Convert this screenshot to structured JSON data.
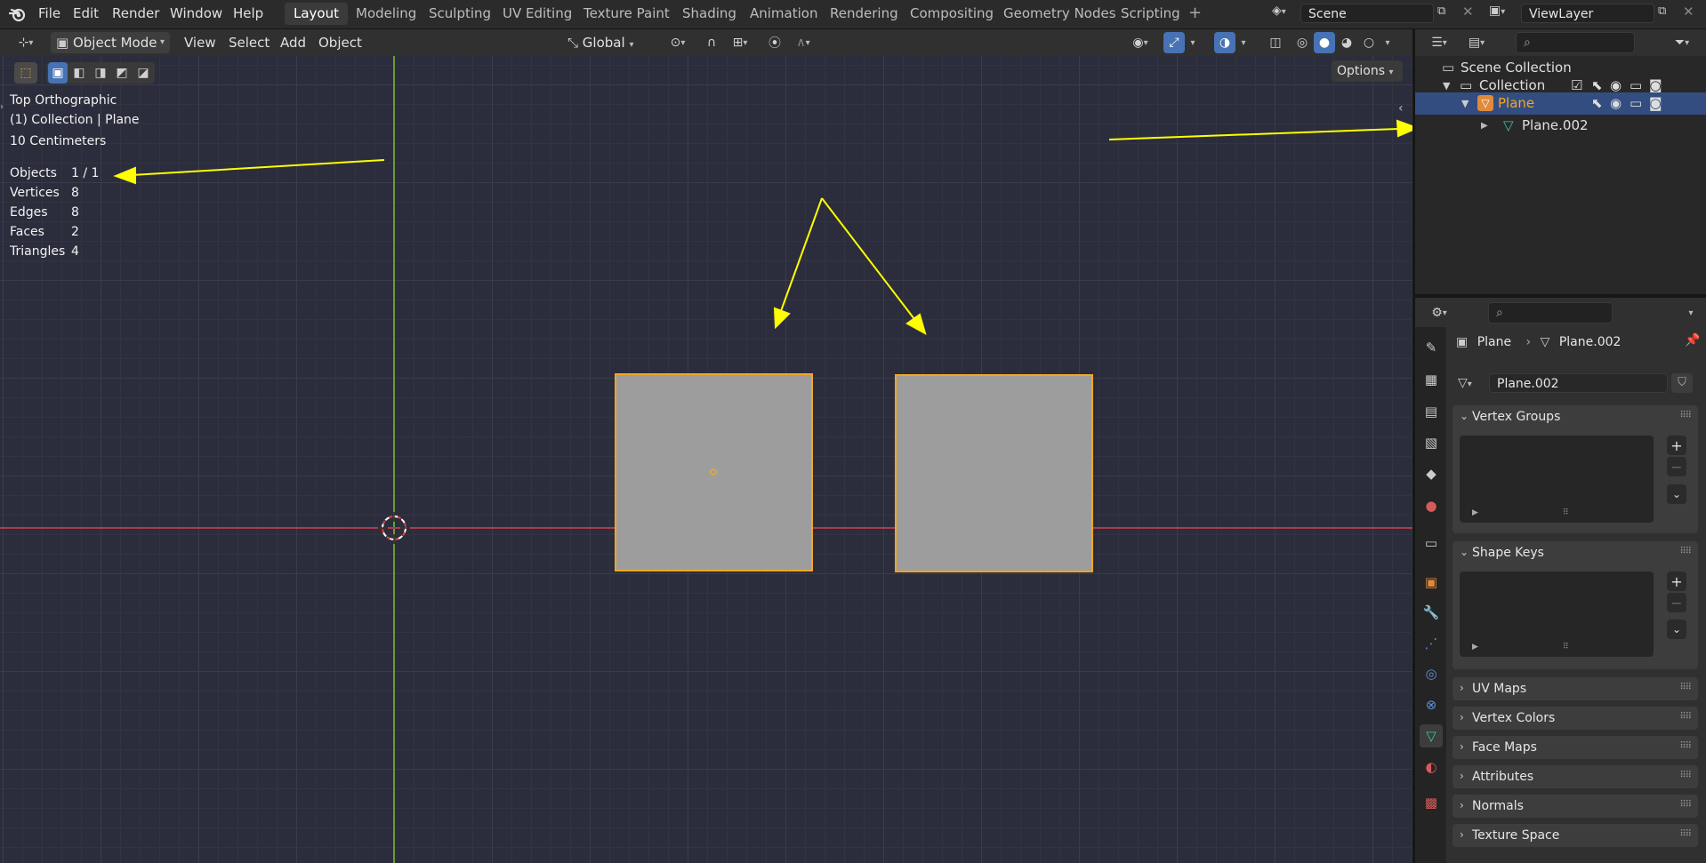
{
  "app": {
    "menus": [
      "File",
      "Edit",
      "Render",
      "Window",
      "Help"
    ],
    "workspaces": [
      "Layout",
      "Modeling",
      "Sculpting",
      "UV Editing",
      "Texture Paint",
      "Shading",
      "Animation",
      "Rendering",
      "Compositing",
      "Geometry Nodes",
      "Scripting"
    ],
    "active_workspace": "Layout",
    "add_workspace": "+",
    "scene_name": "Scene",
    "view_layer_name": "ViewLayer"
  },
  "viewport_header": {
    "mode": "Object Mode",
    "menu_view": "View",
    "menu_select": "Select",
    "menu_add": "Add",
    "menu_object": "Object",
    "orientation": "Global",
    "options_label": "Options"
  },
  "viewport": {
    "view_name": "Top Orthographic",
    "collection_info": "(1) Collection | Plane",
    "scale_info": "10 Centimeters",
    "stats": [
      {
        "label": "Objects",
        "value": "1 / 1"
      },
      {
        "label": "Vertices",
        "value": "8"
      },
      {
        "label": "Edges",
        "value": "8"
      },
      {
        "label": "Faces",
        "value": "2"
      },
      {
        "label": "Triangles",
        "value": "4"
      }
    ],
    "colors": {
      "background": "#2b2d3c",
      "mesh": "#9d9d9d",
      "selection": "#f5a623",
      "annotation": "#ffff00",
      "x_axis": "#a83e4c",
      "y_axis": "#6b9a3a"
    }
  },
  "outliner": {
    "scene_collection": "Scene Collection",
    "collection": "Collection",
    "object": "Plane",
    "mesh": "Plane.002"
  },
  "properties": {
    "breadcrumb_object": "Plane",
    "breadcrumb_mesh": "Plane.002",
    "datablock_name": "Plane.002",
    "panels": {
      "vertex_groups": "Vertex Groups",
      "shape_keys": "Shape Keys",
      "uv_maps": "UV Maps",
      "vertex_colors": "Vertex Colors",
      "face_maps": "Face Maps",
      "attributes": "Attributes",
      "normals": "Normals",
      "texture_space": "Texture Space"
    }
  }
}
